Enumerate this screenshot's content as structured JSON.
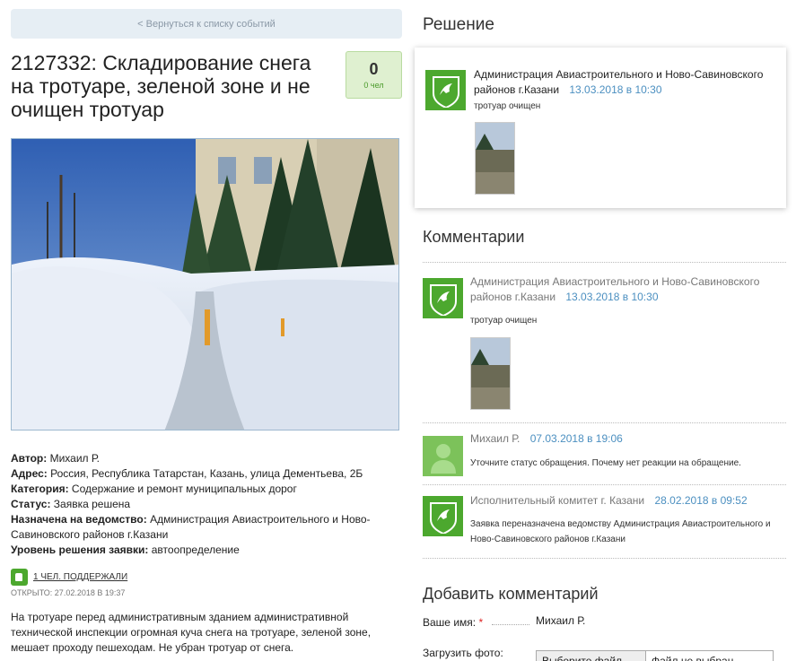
{
  "nav": {
    "back_label": "< Вернуться к списку событий"
  },
  "issue": {
    "title": "2127332: Складирование снега на тротуаре, зеленой зоне и не очищен тротуар",
    "votes": "0",
    "votes_unit": "0 чел"
  },
  "info": {
    "author_label": "Автор:",
    "author": "Михаил Р.",
    "address_label": "Адрес:",
    "address": "Россия, Республика Татарстан, Казань, улица Дементьева, 2Б",
    "category_label": "Категория:",
    "category": "Содержание и ремонт муниципальных дорог",
    "status_label": "Статус:",
    "status": "Заявка решена",
    "assigned_label": "Назначена на ведомство:",
    "assigned": "Администрация Авиастроительного и Ново-Савиновского районов г.Казани",
    "level_label": "Уровень решения заявки:",
    "level": "автоопределение"
  },
  "support": {
    "label": "1 ЧЕЛ. ПОДДЕРЖАЛИ"
  },
  "opened": "ОТКРЫТО: 27.02.2018 В 19:37",
  "description": "На тротуаре перед административным зданием административной технической инспекции огромная куча снега на тротуаре, зеленой зоне, мешает проходу пешеходам. Не убран тротуар от снега.",
  "solution": {
    "heading": "Решение",
    "author": "Администрация Авиастроительного и Ново-Савиновского районов г.Казани",
    "date": "13.03.2018 в 10:30",
    "text": "тротуар очищен"
  },
  "comments": {
    "heading": "Комментарии",
    "items": [
      {
        "author": "Администрация Авиастроительного и Ново-Савиновского районов г.Казани",
        "date": "13.03.2018 в 10:30",
        "text": "тротуар очищен"
      },
      {
        "author": "Михаил Р.",
        "date": "07.03.2018 в 19:06",
        "text": "Уточните статус обращения. Почему нет реакции на обращение."
      },
      {
        "author": "Исполнительный комитет г. Казани",
        "date": "28.02.2018 в 09:52",
        "text": "Заявка переназначена ведомству Администрация Авиастроительного и Ново-Савиновского районов г.Казани"
      }
    ]
  },
  "add_comment": {
    "heading": "Добавить комментарий",
    "name_label": "Ваше имя:",
    "required_mark": "*",
    "name_value": "Михаил Р.",
    "upload_label": "Загрузить фото:",
    "file_button": "Выберите файл",
    "file_status": "Файл не выбран"
  },
  "colors": {
    "accent_green": "#4ca82e",
    "link_blue": "#4b8fc0"
  }
}
